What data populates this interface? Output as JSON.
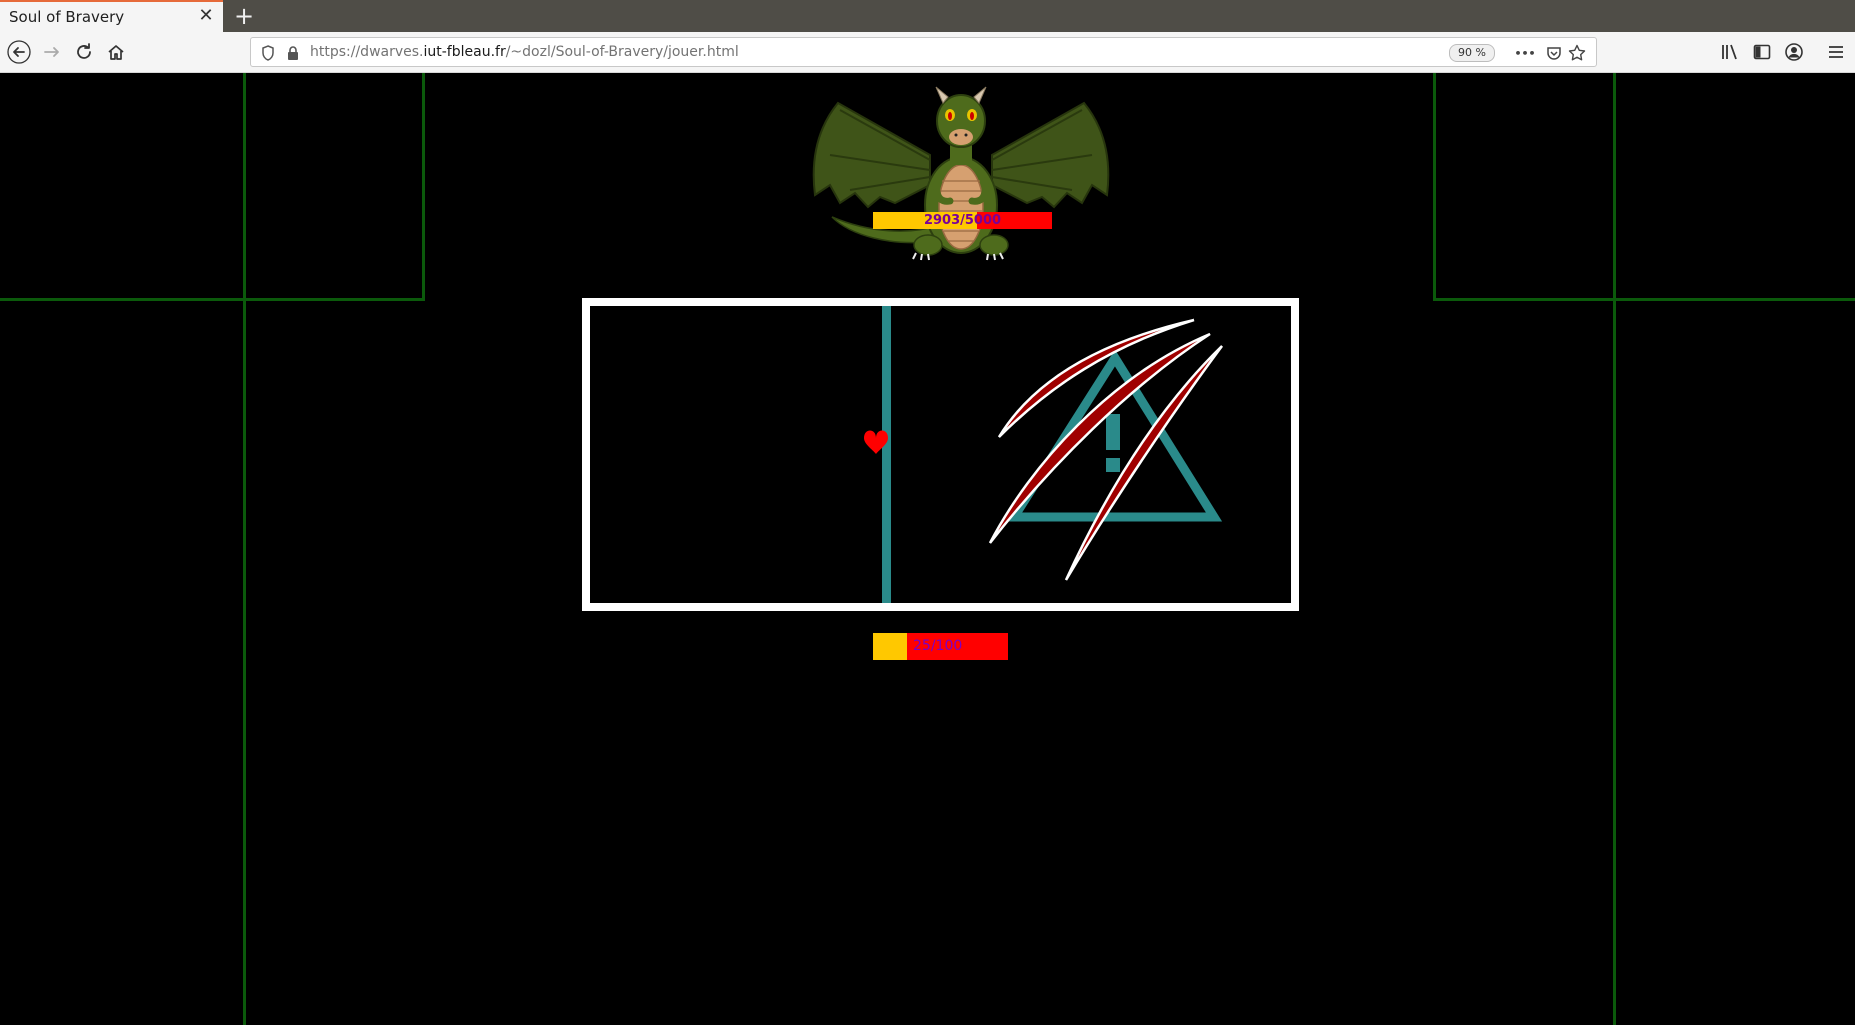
{
  "browser": {
    "tab_title": "Soul of Bravery",
    "tab_close": "✕",
    "new_tab": "+",
    "url_prefix": "https://dwarves.",
    "url_domain": "iut-fbleau.fr",
    "url_path": "/~dozl/Soul-of-Bravery/jouer.html",
    "zoom": "90 %",
    "page_actions": "•••"
  },
  "game": {
    "boss": {
      "hp_text": "2903/5000",
      "hp_current": 2903,
      "hp_max": 5000
    },
    "player": {
      "hp_text": "25/100",
      "hp_current": 25,
      "hp_max": 100
    }
  },
  "colors": {
    "background": "#000000",
    "grid_line": "#0b5a0b",
    "arena_border": "#ffffff",
    "hp_fill": "#ffc800",
    "hp_empty": "#ff0000",
    "soul_heart": "#ff0000",
    "wall": "#2a8a8a",
    "claw": "#a00000"
  }
}
